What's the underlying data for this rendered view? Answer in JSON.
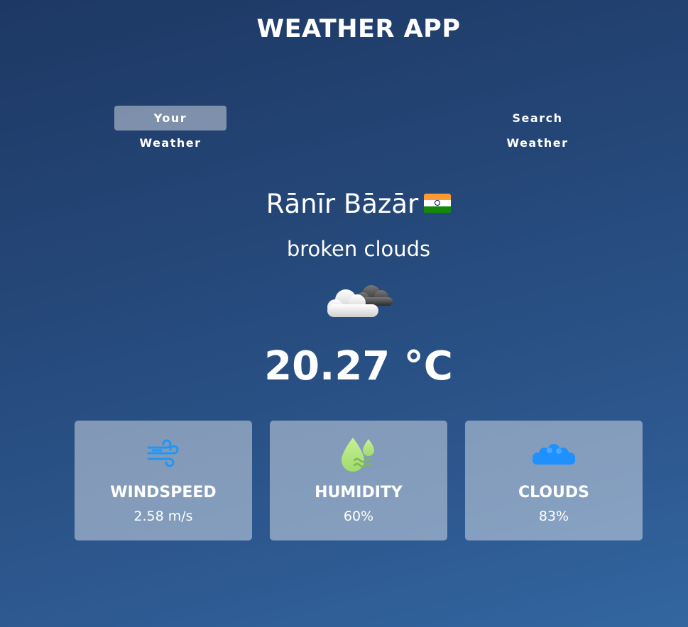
{
  "app": {
    "title": "WEATHER APP"
  },
  "tabs": [
    {
      "label": "Your Weather",
      "active": true
    },
    {
      "label": "Search Weather",
      "active": false
    }
  ],
  "location": {
    "city": "Rānīr Bāzār",
    "country_flag": "India"
  },
  "weather": {
    "description": "broken clouds",
    "icon": "broken-clouds-icon",
    "temperature": "20.27 °C"
  },
  "stats": [
    {
      "label": "WINDSPEED",
      "value": "2.58 m/s",
      "icon": "wind-icon"
    },
    {
      "label": "HUMIDITY",
      "value": "60%",
      "icon": "humidity-icon"
    },
    {
      "label": "CLOUDS",
      "value": "83%",
      "icon": "clouds-icon"
    }
  ],
  "colors": {
    "background_top": "#1d3864",
    "background_bottom": "#33669f",
    "wind_icon": "#2196f3",
    "humidity_icon": "#b8e986",
    "clouds_icon": "#1e90ff"
  }
}
